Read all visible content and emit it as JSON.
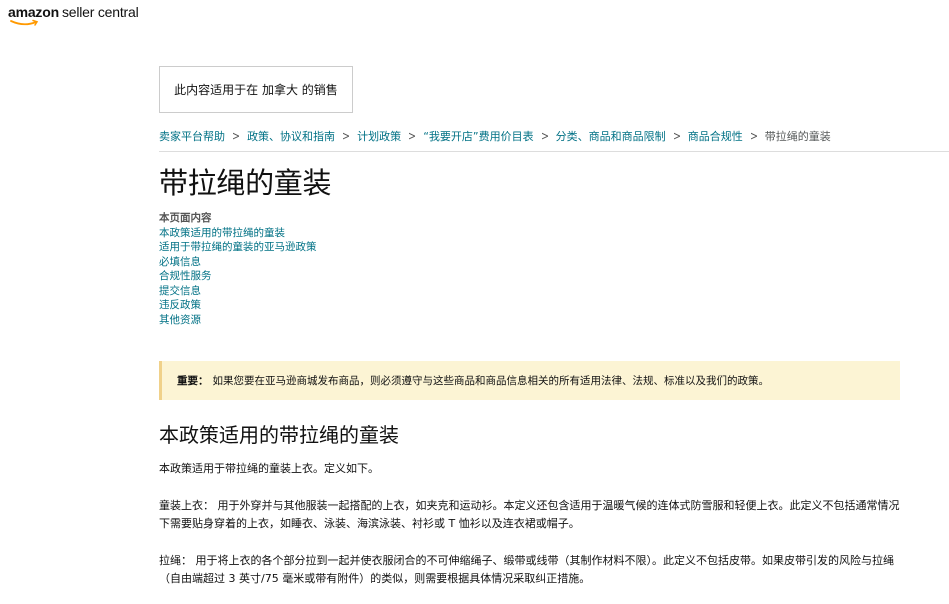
{
  "header": {
    "logo_brand": "amazon",
    "logo_product": "seller central"
  },
  "marketplace_notice": "此内容适用于在 加拿大 的销售",
  "breadcrumb": [
    "卖家平台帮助",
    "政策、协议和指南",
    "计划政策",
    "“我要开店”费用价目表",
    "分类、商品和商品限制",
    "商品合规性",
    "带拉绳的童装"
  ],
  "page_title": "带拉绳的童装",
  "toc": {
    "heading": "本页面内容",
    "items": [
      "本政策适用的带拉绳的童装",
      "适用于带拉绳的童装的亚马逊政策",
      "必填信息",
      "合规性服务",
      "提交信息",
      "违反政策",
      "其他资源"
    ]
  },
  "alert": {
    "label": "重要：",
    "text": "如果您要在亚马逊商城发布商品，则必须遵守与这些商品和商品信息相关的所有适用法律、法规、标准以及我们的政策。"
  },
  "section": {
    "title": "本政策适用的带拉绳的童装",
    "intro": "本政策适用于带拉绳的童装上衣。定义如下。",
    "definitions": [
      {
        "term": "童装上衣：",
        "text": "用于外穿并与其他服装一起搭配的上衣，如夹克和运动衫。本定义还包含适用于温暖气候的连体式防雪服和轻便上衣。此定义不包括通常情况下需要贴身穿着的上衣，如睡衣、泳装、海滨泳装、衬衫或 T 恤衫以及连衣裙或帽子。"
      },
      {
        "term": "拉绳：",
        "text": "用于将上衣的各个部分拉到一起并使衣服闭合的不可伸缩绳子、缎带或线带（其制作材料不限）。此定义不包括皮带。如果皮带引发的风险与拉绳（自由端超过 3 英寸/75 毫米或带有附件）的类似，则需要根据具体情况采取纠正措施。"
      }
    ]
  },
  "colors": {
    "link": "#007185",
    "alert_bg": "#fcf4d4",
    "alert_border": "#f0d18a",
    "logo_smile": "#ff9900"
  }
}
